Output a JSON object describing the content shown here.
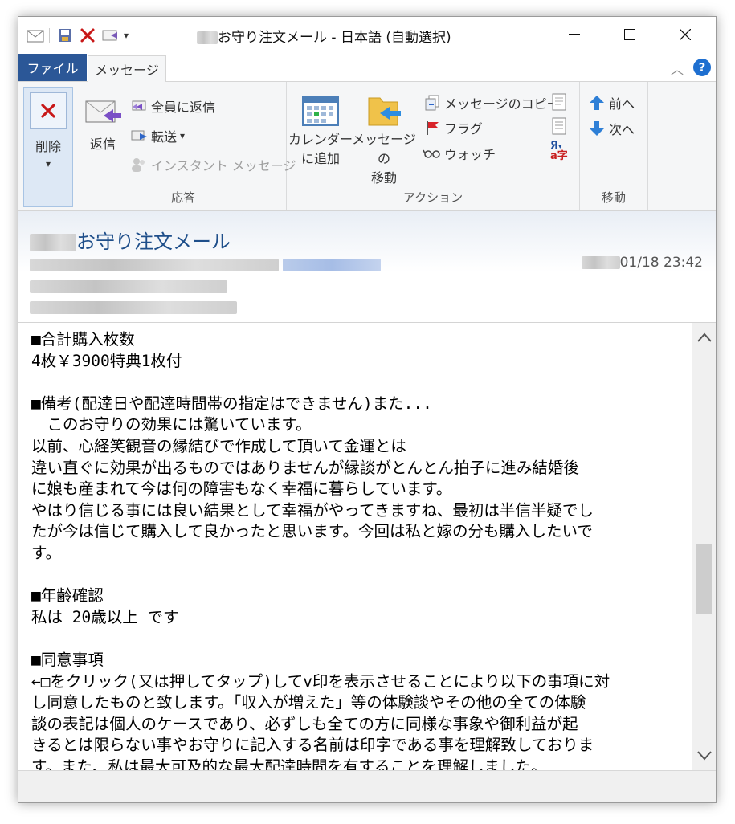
{
  "window": {
    "title_suffix": "お守り注文メール - 日本語 (自動選択)",
    "minimize_label": "—",
    "maximize_label": "☐",
    "close_label": "✕"
  },
  "tabs": {
    "file": "ファイル",
    "message": "メッセージ"
  },
  "ribbon": {
    "delete": {
      "label": "削除",
      "dropdown": "▾"
    },
    "respond": {
      "reply": "返信",
      "reply_all": "全員に返信",
      "forward": "転送",
      "forward_dropdown": "▾",
      "instant_message": "インスタント メッセージ",
      "group_label": "応答"
    },
    "actions": {
      "calendar_line1": "カレンダー",
      "calendar_line2": "に追加",
      "move_line1": "メッセージの",
      "move_line2": "移動",
      "copy": "メッセージのコピー",
      "flag": "フラグ",
      "watch": "ウォッチ",
      "group_label": "アクション"
    },
    "navigation": {
      "previous": "前へ",
      "next": "次へ",
      "group_label": "移動"
    }
  },
  "header": {
    "subject_suffix": "お守り注文メール",
    "date": "01/18 23:42"
  },
  "body": {
    "text": "■合計購入枚数\n4枚￥3900特典1枚付\n\n■備考(配達日や配達時間帯の指定はできません)また...\n　このお守りの効果には驚いています。\n以前、心経笑観音の縁結びで作成して頂いて金運とは\n違い直ぐに効果が出るものではありませんが縁談がとんとん拍子に進み結婚後\nに娘も産まれて今は何の障害もなく幸福に暮らしています。\nやはり信じる事には良い結果として幸福がやってきますね、最初は半信半疑でし\nたが今は信じて購入して良かったと思います。今回は私と嫁の分も購入したいで\nす。\n\n■年齢確認\n私は 20歳以上 です\n\n■同意事項\n←□をクリック(又は押してタップ)してv印を表示させることにより以下の事項に対\nし同意したものと致します。「収入が増えた」等の体験談やその他の全ての体験\n談の表記は個人のケースであり、必ずしも全ての方に同様な事象や御利益が起\nきるとは限らない事やお守りに記入する名前は印字である事を理解致しておりま\nす。また、私は最大可及的な最大配達時間を有することを理解しました。"
  },
  "scrollbar": {
    "position": 0.6,
    "visible_fraction": 0.18
  },
  "colors": {
    "file_tab": "#2b5797",
    "subject": "#1f4f8a",
    "accent": "#1e6fd0"
  }
}
